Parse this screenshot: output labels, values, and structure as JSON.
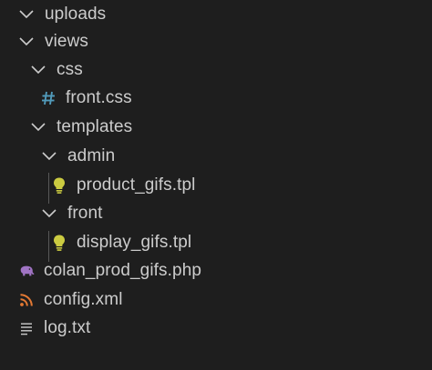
{
  "colors": {
    "background": "#1e1e1e",
    "text": "#cccccc",
    "hash_icon": "#519aba",
    "tpl_icon": "#cbcb41",
    "php_icon": "#a074c4",
    "xml_icon": "#e37933",
    "txt_icon": "#cccccc"
  },
  "explorer": {
    "items": [
      {
        "label": "uploads",
        "icon": "chevron-down-icon"
      },
      {
        "label": "views",
        "icon": "chevron-down-icon"
      },
      {
        "label": "css",
        "icon": "chevron-down-icon"
      },
      {
        "label": "front.css",
        "icon": "hash-icon"
      },
      {
        "label": "templates",
        "icon": "chevron-down-icon"
      },
      {
        "label": "admin",
        "icon": "chevron-down-icon"
      },
      {
        "label": "product_gifs.tpl",
        "icon": "lightbulb-icon"
      },
      {
        "label": "front",
        "icon": "chevron-down-icon"
      },
      {
        "label": "display_gifs.tpl",
        "icon": "lightbulb-icon"
      },
      {
        "label": "colan_prod_gifs.php",
        "icon": "elephant-icon"
      },
      {
        "label": "config.xml",
        "icon": "rss-icon"
      },
      {
        "label": "log.txt",
        "icon": "text-lines-icon"
      }
    ]
  }
}
